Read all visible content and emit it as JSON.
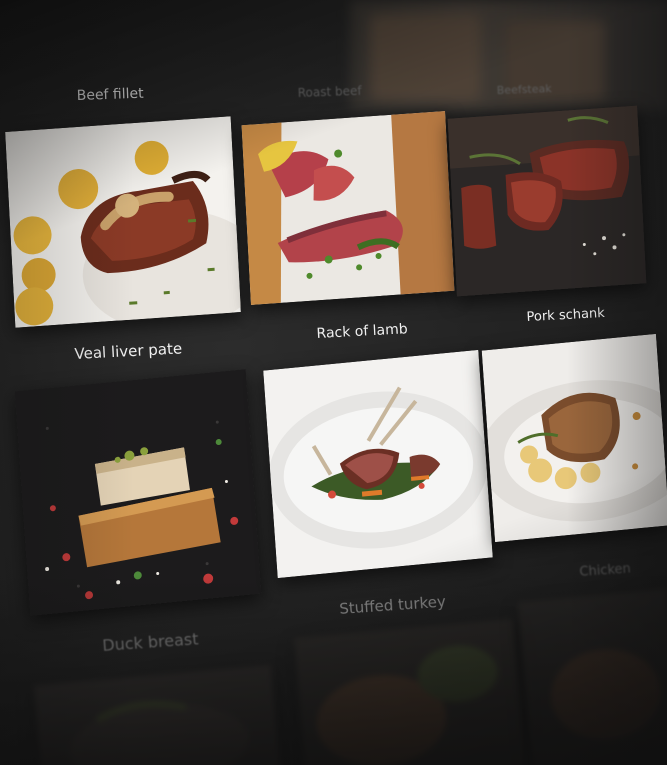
{
  "menu": {
    "items": [
      {
        "label": "Beef fillet"
      },
      {
        "label": "Roast beef"
      },
      {
        "label": "Beefsteak"
      },
      {
        "label": "Veal liver pate"
      },
      {
        "label": "Rack of lamb"
      },
      {
        "label": "Pork schank"
      },
      {
        "label": "Duck breast"
      },
      {
        "label": "Stuffed turkey"
      },
      {
        "label": "Chicken"
      }
    ]
  }
}
